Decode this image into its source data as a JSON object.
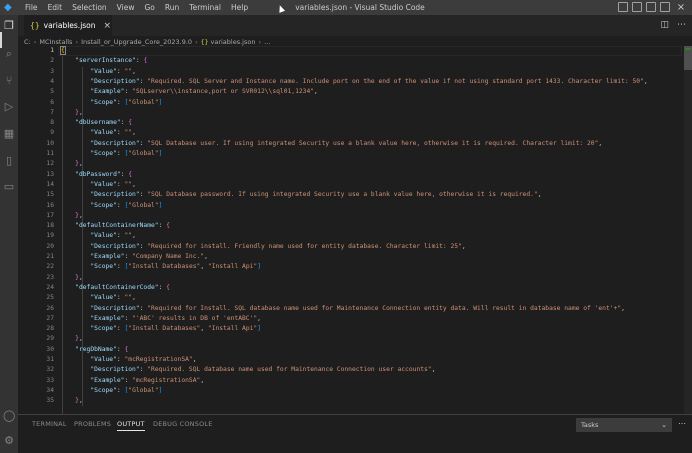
{
  "window": {
    "title": "variables.json - Visual Studio Code",
    "menu": [
      "File",
      "Edit",
      "Selection",
      "View",
      "Go",
      "Run",
      "Terminal",
      "Help"
    ]
  },
  "activity_bar": {
    "icons": [
      "explorer-icon",
      "search-icon",
      "source-control-icon",
      "run-debug-icon",
      "extensions-icon",
      "bookmark-icon",
      "remote-explorer-icon",
      "account-icon",
      "settings-gear-icon"
    ]
  },
  "tab": {
    "icon": "{}",
    "label": "variables.json",
    "close": "×"
  },
  "breadcrumb": {
    "parts": [
      "C:",
      "MCInstalls",
      "Install_or_Upgrade_Core_2023.9.0",
      "variables.json",
      "..."
    ],
    "json_icon": "{}"
  },
  "editor": {
    "line_numbers": [
      "1",
      "2",
      "3",
      "4",
      "5",
      "6",
      "7",
      "8",
      "9",
      "10",
      "11",
      "12",
      "13",
      "14",
      "15",
      "16",
      "17",
      "18",
      "19",
      "20",
      "21",
      "22",
      "23",
      "24",
      "25",
      "26",
      "27",
      "28",
      "29",
      "30",
      "31",
      "32",
      "33",
      "34",
      "35"
    ],
    "current_line": "1",
    "lines": [
      {
        "indent": "",
        "key": "",
        "value": "",
        "open": "{",
        "close": ""
      },
      {
        "indent": "    ",
        "key": "\"serverInstance\"",
        "sep": ": ",
        "open": "{"
      },
      {
        "indent": "        ",
        "key": "\"Value\"",
        "sep": ": ",
        "value": "\"\"",
        "tail": ","
      },
      {
        "indent": "        ",
        "key": "\"Description\"",
        "sep": ": ",
        "value": "\"Required. SQL Server and Instance name. Include port on the end of the value if not using standard port 1433. Character limit: 50\"",
        "tail": ","
      },
      {
        "indent": "        ",
        "key": "\"Example\"",
        "sep": ": ",
        "value": "\"SQLserver\\\\instance,port or SVR012\\\\sql01,1234\"",
        "tail": ","
      },
      {
        "indent": "        ",
        "key": "\"Scope\"",
        "sep": ": ",
        "arr": [
          "\"Global\""
        ]
      },
      {
        "indent": "    ",
        "close": "},"
      },
      {
        "indent": "    ",
        "key": "\"dbUsername\"",
        "sep": ": ",
        "open": "{"
      },
      {
        "indent": "        ",
        "key": "\"Value\"",
        "sep": ": ",
        "value": "\"\"",
        "tail": ","
      },
      {
        "indent": "        ",
        "key": "\"Description\"",
        "sep": ": ",
        "value": "\"SQL Database user. If using integrated Security use a blank value here, otherwise it is required. Character limit: 20\"",
        "tail": ","
      },
      {
        "indent": "        ",
        "key": "\"Scope\"",
        "sep": ": ",
        "arr": [
          "\"Global\""
        ]
      },
      {
        "indent": "    ",
        "close": "},"
      },
      {
        "indent": "    ",
        "key": "\"dbPassword\"",
        "sep": ": ",
        "open": "{"
      },
      {
        "indent": "        ",
        "key": "\"Value\"",
        "sep": ": ",
        "value": "\"\"",
        "tail": ","
      },
      {
        "indent": "        ",
        "key": "\"Description\"",
        "sep": ": ",
        "value": "\"SQL Database password. If using integrated Security use a blank value here, otherwise it is required.\"",
        "tail": ","
      },
      {
        "indent": "        ",
        "key": "\"Scope\"",
        "sep": ": ",
        "arr": [
          "\"Global\""
        ]
      },
      {
        "indent": "    ",
        "close": "},"
      },
      {
        "indent": "    ",
        "key": "\"defaultContainerName\"",
        "sep": ": ",
        "open": "{"
      },
      {
        "indent": "        ",
        "key": "\"Value\"",
        "sep": ": ",
        "value": "\"\"",
        "tail": ","
      },
      {
        "indent": "        ",
        "key": "\"Description\"",
        "sep": ": ",
        "value": "\"Required for install. Friendly name used for entity database. Character limit: 25\"",
        "tail": ","
      },
      {
        "indent": "        ",
        "key": "\"Example\"",
        "sep": ": ",
        "value": "\"Company Name Inc.\"",
        "tail": ","
      },
      {
        "indent": "        ",
        "key": "\"Scope\"",
        "sep": ": ",
        "arr": [
          "\"Install Databases\"",
          "\"Install Api\""
        ]
      },
      {
        "indent": "    ",
        "close": "},"
      },
      {
        "indent": "    ",
        "key": "\"defaultContainerCode\"",
        "sep": ": ",
        "open": "{"
      },
      {
        "indent": "        ",
        "key": "\"Value\"",
        "sep": ": ",
        "value": "\"\"",
        "tail": ","
      },
      {
        "indent": "        ",
        "key": "\"Description\"",
        "sep": ": ",
        "value": "\"Required for Install. SQL database name used for Maintenance Connection entity data. Will result in database name of 'ent'+\"",
        "tail": ","
      },
      {
        "indent": "        ",
        "key": "\"Example\"",
        "sep": ": ",
        "value": "\"'ABC' results in DB of 'entABC'\"",
        "tail": ","
      },
      {
        "indent": "        ",
        "key": "\"Scope\"",
        "sep": ": ",
        "arr": [
          "\"Install Databases\"",
          "\"Install Api\""
        ]
      },
      {
        "indent": "    ",
        "close": "},"
      },
      {
        "indent": "    ",
        "key": "\"regDbName\"",
        "sep": ": ",
        "open": "{"
      },
      {
        "indent": "        ",
        "key": "\"Value\"",
        "sep": ": ",
        "value": "\"mcRegistrationSA\"",
        "tail": ","
      },
      {
        "indent": "        ",
        "key": "\"Description\"",
        "sep": ": ",
        "value": "\"Required. SQL database name used for Maintenance Connection user accounts\"",
        "tail": ","
      },
      {
        "indent": "        ",
        "key": "\"Example\"",
        "sep": ": ",
        "value": "\"mcRegistrationSA\"",
        "tail": ","
      },
      {
        "indent": "        ",
        "key": "\"Scope\"",
        "sep": ": ",
        "arr": [
          "\"Global\""
        ]
      },
      {
        "indent": "    ",
        "close": "},"
      }
    ]
  },
  "panel": {
    "tabs": [
      "TERMINAL",
      "PROBLEMS",
      "OUTPUT",
      "DEBUG CONSOLE"
    ],
    "active_tab": "OUTPUT",
    "output_channel": "Tasks"
  }
}
